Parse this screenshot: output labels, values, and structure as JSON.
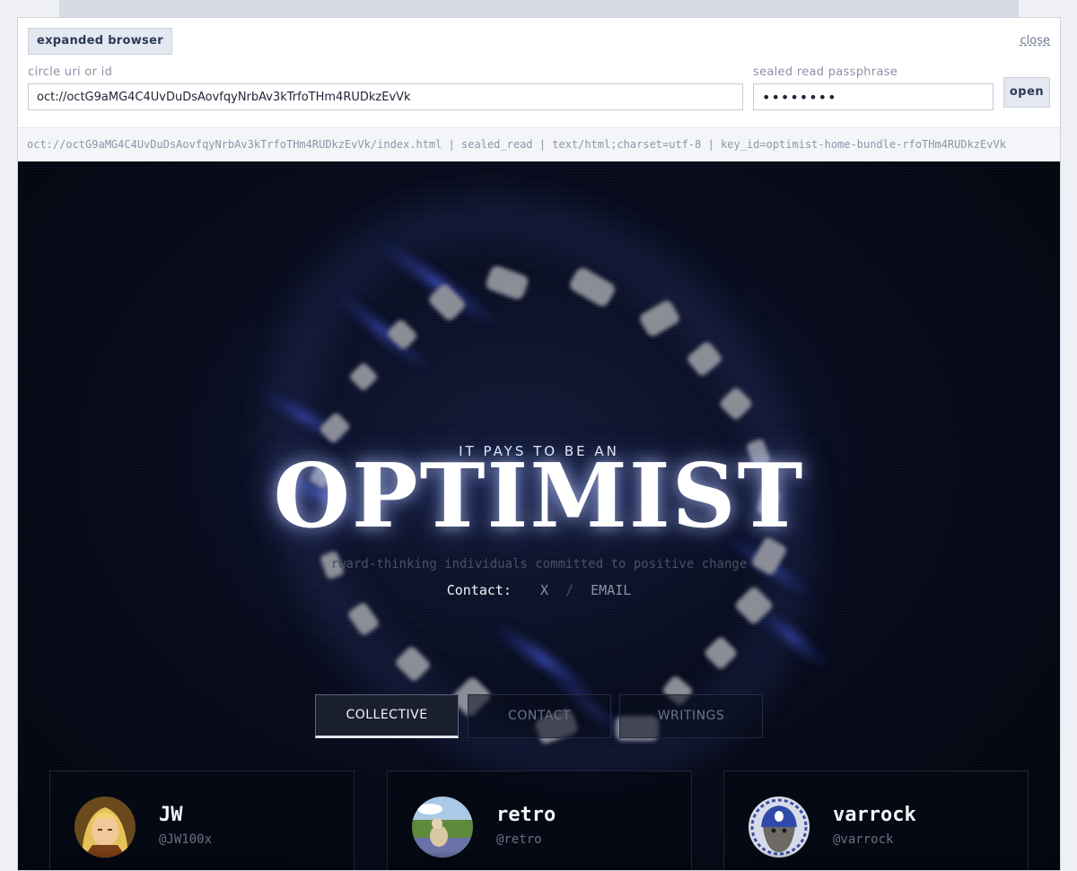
{
  "browser": {
    "title": "expanded browser",
    "close_label": "close",
    "uri_label": "circle uri or id",
    "uri_value": "oct://octG9aMG4C4UvDuDsAovfqyNrbAv3kTrfoTHm4RUDkzEvVk",
    "pass_label": "sealed read passphrase",
    "pass_value": "••••••••",
    "open_label": "open",
    "meta": "oct://octG9aMG4C4UvDuDsAovfqyNrbAv3kTrfoTHm4RUDkzEvVk/index.html | sealed_read | text/html;charset=utf-8 | key_id=optimist-home-bundle-rfoTHm4RUDkzEvVk"
  },
  "site": {
    "tagline": "IT PAYS TO BE AN",
    "hero": "OPTIMIST",
    "subtitle": "rward-thinking individuals committed to positive change",
    "contact_label": "Contact:",
    "contact_x": "X",
    "contact_sep": "/",
    "contact_email": "EMAIL",
    "tabs": [
      "COLLECTIVE",
      "CONTACT",
      "WRITINGS"
    ],
    "active_tab": "COLLECTIVE",
    "members": [
      {
        "name": "JW",
        "handle": "@JW100x",
        "avatar": "blond-anime-character"
      },
      {
        "name": "retro",
        "handle": "@retro",
        "avatar": "dog-in-meadow"
      },
      {
        "name": "varrock",
        "handle": "@varrock",
        "avatar": "bearded-gnome-with-helmet"
      }
    ]
  },
  "colors": {
    "accent_ring": "#8d8f99",
    "flare_blue": "#3d4fd8",
    "page_bg": "#03050c"
  }
}
